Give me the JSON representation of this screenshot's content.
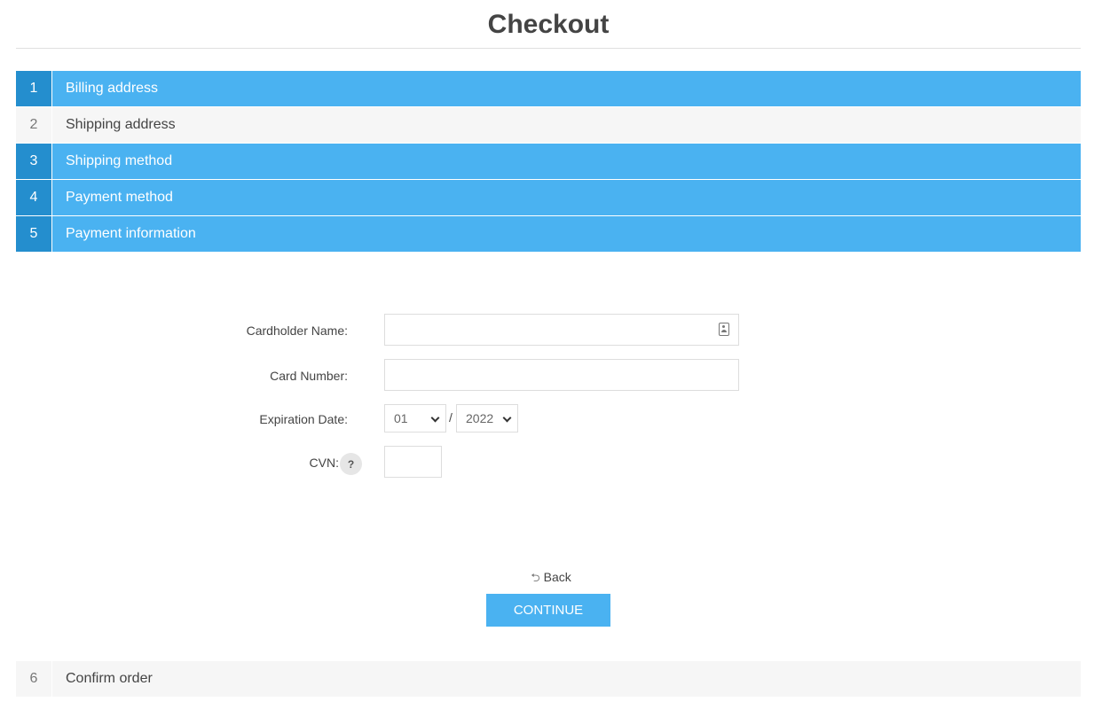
{
  "page": {
    "title": "Checkout"
  },
  "steps": [
    {
      "number": "1",
      "label": "Billing address",
      "state": "allowed"
    },
    {
      "number": "2",
      "label": "Shipping address",
      "state": "inactive"
    },
    {
      "number": "3",
      "label": "Shipping method",
      "state": "allowed"
    },
    {
      "number": "4",
      "label": "Payment method",
      "state": "allowed"
    },
    {
      "number": "5",
      "label": "Payment information",
      "state": "allowed"
    },
    {
      "number": "6",
      "label": "Confirm order",
      "state": "inactive"
    }
  ],
  "payment_form": {
    "cardholder_label": "Cardholder Name:",
    "cardholder_value": "",
    "card_number_label": "Card Number:",
    "card_number_value": "",
    "expiration_label": "Expiration Date:",
    "expire_month": "01",
    "expire_separator": "/",
    "expire_year": "2022",
    "cvn_label": "CVN:",
    "cvn_help": "?",
    "cvn_value": ""
  },
  "actions": {
    "back_label": "Back",
    "back_icon": "⮌",
    "continue_label": "Continue"
  },
  "colors": {
    "step_active_bg": "#4ab2f1",
    "step_number_bg": "#248ece",
    "step_inactive_bg": "#f6f6f6",
    "button_bg": "#4ab2f1"
  }
}
